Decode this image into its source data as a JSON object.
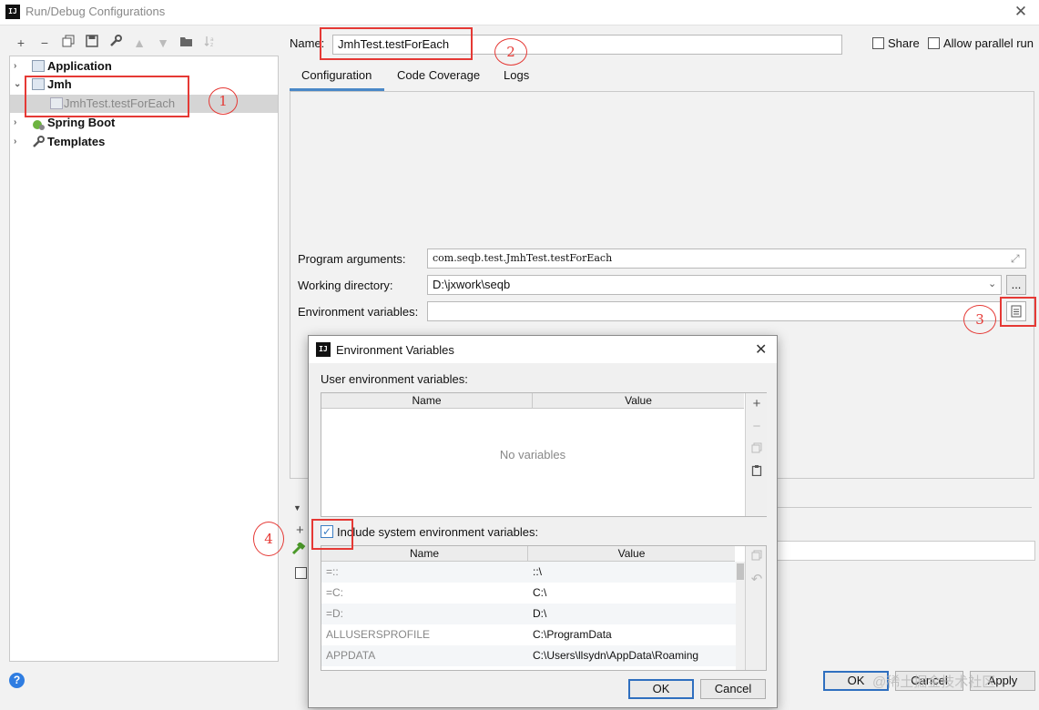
{
  "window": {
    "title": "Run/Debug Configurations",
    "icon_text": "IJ",
    "close_glyph": "✕"
  },
  "toolbar": [
    "plus-icon",
    "minus-icon",
    "copy-icon",
    "save-icon",
    "wrench-icon",
    "arrow-up-icon",
    "arrow-down-icon",
    "folder-icon",
    "sort-icon"
  ],
  "tree": {
    "items": [
      {
        "label": "Application",
        "arrow": "›"
      },
      {
        "label": "Jmh",
        "arrow": "⌄"
      },
      {
        "label": "JmhTest.testForEach",
        "arrow": ""
      },
      {
        "label": "Spring Boot",
        "arrow": "›"
      },
      {
        "label": "Templates",
        "arrow": "›"
      }
    ]
  },
  "header": {
    "name_label": "Name:",
    "name_value": "JmhTest.testForEach",
    "share_label": "Share",
    "parallel_label": "Allow parallel run"
  },
  "tabs": [
    {
      "label": "Configuration",
      "active": true
    },
    {
      "label": "Code Coverage",
      "active": false
    },
    {
      "label": "Logs",
      "active": false
    }
  ],
  "config": {
    "program_args_label": "Program arguments:",
    "program_args_value": "com.seqb.test.JmhTest.testForEach",
    "workdir_label": "Working directory:",
    "workdir_value": "D:\\jxwork\\seqb",
    "workdir_browse": "...",
    "env_label": "Environment variables:",
    "env_value": ""
  },
  "annotations": [
    "1",
    "2",
    "3",
    "4"
  ],
  "dialog": {
    "title": "Environment Variables",
    "icon_text": "IJ",
    "close_glyph": "✕",
    "user_vars_label": "User environment variables:",
    "col_name": "Name",
    "col_value": "Value",
    "empty_text": "No variables",
    "include_label": "Include system environment variables:",
    "include_checked": true,
    "system_vars": [
      {
        "name": "=::",
        "value": "::\\"
      },
      {
        "name": "=C:",
        "value": "C:\\"
      },
      {
        "name": "=D:",
        "value": "D:\\"
      },
      {
        "name": "ALLUSERSPROFILE",
        "value": "C:\\ProgramData"
      },
      {
        "name": "APPDATA",
        "value": "C:\\Users\\llsydn\\AppData\\Roaming"
      }
    ],
    "ok": "OK",
    "cancel": "Cancel"
  },
  "footer": {
    "help": "?",
    "ok": "OK",
    "cancel": "Cancel",
    "apply": "Apply",
    "watermark": "@稀土掘金技术社区"
  },
  "colors": {
    "annotation": "#e53935",
    "accent": "#4a88c7",
    "default_button": "#2f6fbf"
  }
}
